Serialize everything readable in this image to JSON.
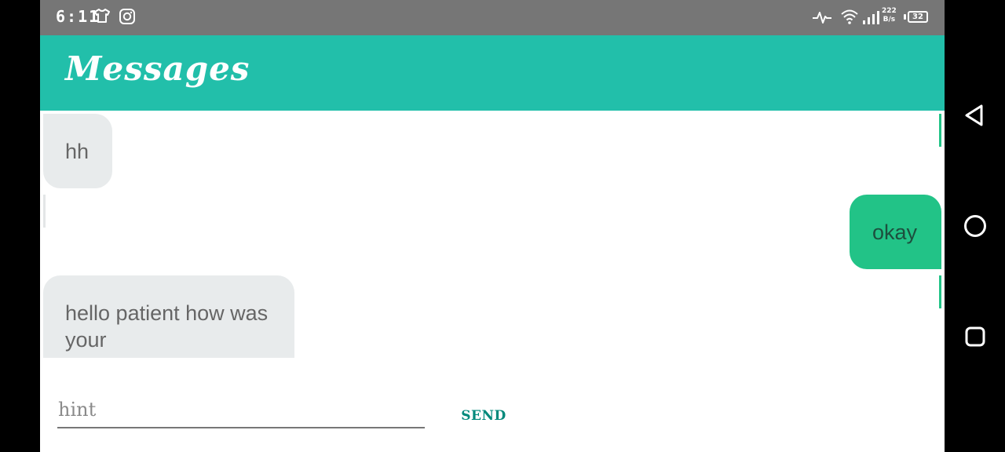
{
  "status_bar": {
    "time": "6:11",
    "network_speed": "222",
    "network_speed_unit": "B/s",
    "battery": "32",
    "icons": [
      "shirt-icon",
      "instagram-icon",
      "activity-icon",
      "wifi-icon",
      "signal-icon",
      "battery-icon"
    ]
  },
  "app_bar": {
    "title": "Messages"
  },
  "messages": [
    {
      "text": "hh",
      "direction": "incoming"
    },
    {
      "text": "okay",
      "direction": "outgoing"
    },
    {
      "text": "hello patient how was your",
      "direction": "incoming"
    }
  ],
  "composer": {
    "placeholder": "hint",
    "send_label": "SEND"
  },
  "nav": {
    "icons": [
      "back-icon",
      "home-icon",
      "recents-icon"
    ]
  },
  "colors": {
    "accent": "#22bfaa",
    "outgoing_bubble": "#22c387",
    "incoming_bubble": "#e8ebec",
    "status_bar": "#767676",
    "send": "#00897b"
  }
}
